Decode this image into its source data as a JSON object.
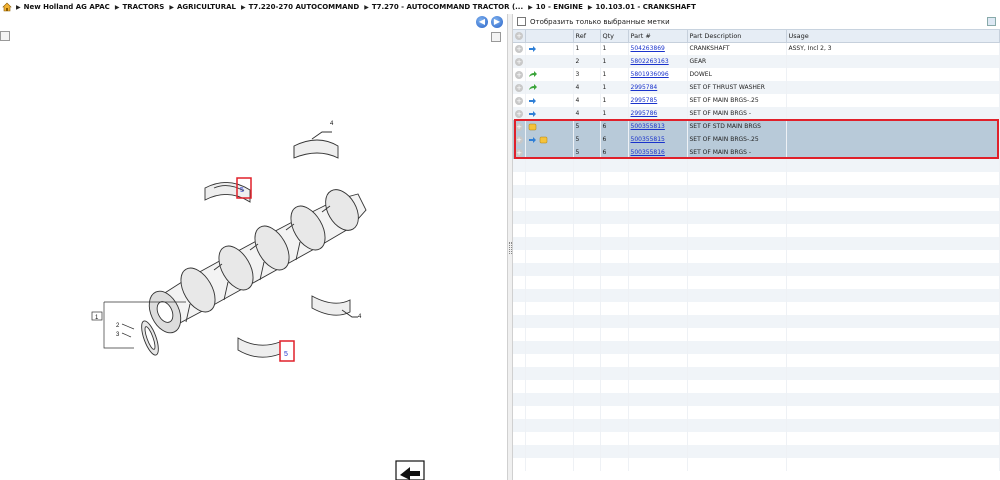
{
  "breadcrumb": {
    "items": [
      "New Holland AG APAC",
      "TRACTORS",
      "AGRICULTURAL",
      "T7.220-270 AUTOCOMMAND",
      "T7.270 - AUTOCOMMAND TRACTOR (...",
      "10 - ENGINE",
      "10.103.01 - CRANKSHAFT"
    ]
  },
  "diagram": {
    "callouts": {
      "ref1": "1",
      "ref2": "2",
      "ref3": "3",
      "ref4_top": "4",
      "ref4_right": "4",
      "ref5_top": "5",
      "ref5_bottom": "5"
    }
  },
  "filter": {
    "label": "Отобразить только выбранные метки"
  },
  "table": {
    "headers": {
      "ref": "Ref",
      "qty": "Qty",
      "part": "Part #",
      "desc": "Part Description",
      "usage": "Usage"
    },
    "rows": [
      {
        "ref": "1",
        "qty": "1",
        "part": "504263869",
        "desc": "CRANKSHAFT",
        "usage": "ASSY, Incl 2, 3",
        "icons": [
          "swap-blue-icon"
        ],
        "selected": false
      },
      {
        "ref": "2",
        "qty": "1",
        "part": "5802263163",
        "desc": "GEAR",
        "usage": "",
        "icons": [],
        "selected": false
      },
      {
        "ref": "3",
        "qty": "1",
        "part": "5801936096",
        "desc": "DOWEL",
        "usage": "",
        "icons": [
          "arrow-green-icon"
        ],
        "selected": false
      },
      {
        "ref": "4",
        "qty": "1",
        "part": "2995784",
        "desc": "SET OF THRUST WASHER",
        "usage": "",
        "icons": [
          "arrow-green-icon"
        ],
        "selected": false
      },
      {
        "ref": "4",
        "qty": "1",
        "part": "2995785",
        "desc": "SET OF MAIN BRGS-.25",
        "usage": "",
        "icons": [
          "swap-blue-icon"
        ],
        "selected": false
      },
      {
        "ref": "4",
        "qty": "1",
        "part": "2995786",
        "desc": "SET OF MAIN BRGS  -",
        "usage": "",
        "icons": [
          "swap-blue-icon"
        ],
        "selected": false
      },
      {
        "ref": "5",
        "qty": "6",
        "part": "500355813",
        "desc": "SET OF STD MAIN BRGS",
        "usage": "",
        "icons": [
          "note-yellow-icon"
        ],
        "selected": true
      },
      {
        "ref": "5",
        "qty": "6",
        "part": "500355815",
        "desc": "SET OF MAIN BRGS-.25",
        "usage": "",
        "icons": [
          "swap-blue-icon",
          "note-yellow-icon"
        ],
        "selected": true
      },
      {
        "ref": "5",
        "qty": "6",
        "part": "500355816",
        "desc": "SET OF MAIN BRGS  -",
        "usage": "",
        "icons": [],
        "selected": true
      }
    ],
    "empty_rows": 24
  },
  "colors": {
    "accent": "#2a64c8",
    "highlight": "#e0202a",
    "selected_row": "#b8cad9",
    "header": "#e6edf5"
  }
}
